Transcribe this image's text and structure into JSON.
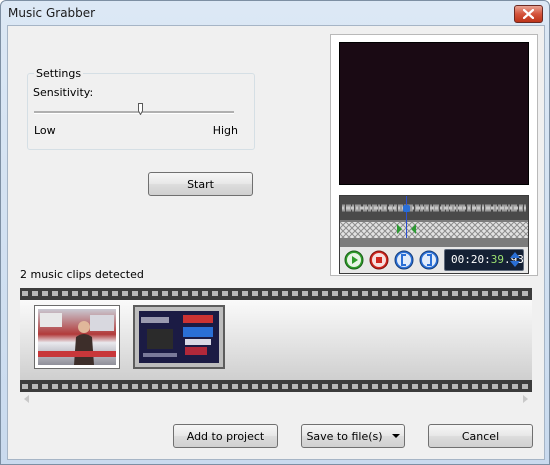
{
  "window": {
    "title": "Music Grabber"
  },
  "settings": {
    "group_label": "Settings",
    "sensitivity_label": "Sensitivity:",
    "sensitivity_level": 0.53,
    "low_label": "Low",
    "high_label": "High"
  },
  "start_label": "Start",
  "preview": {
    "time_prefix": "00:20:",
    "time_highlight": "39",
    "time_suffix": ".93",
    "playhead_position": 0.35
  },
  "clips": {
    "count_label": "2 music clips detected",
    "items": [
      {
        "name": "clip-1",
        "selected": false
      },
      {
        "name": "clip-2",
        "selected": true
      }
    ]
  },
  "footer": {
    "add_label": "Add to project",
    "save_label": "Save to file(s)",
    "cancel_label": "Cancel"
  },
  "colors": {
    "accent": "#2a6fd6",
    "play_green": "#2f9b2a",
    "stop_red": "#d0261e",
    "time_highlight": "#9be070"
  }
}
